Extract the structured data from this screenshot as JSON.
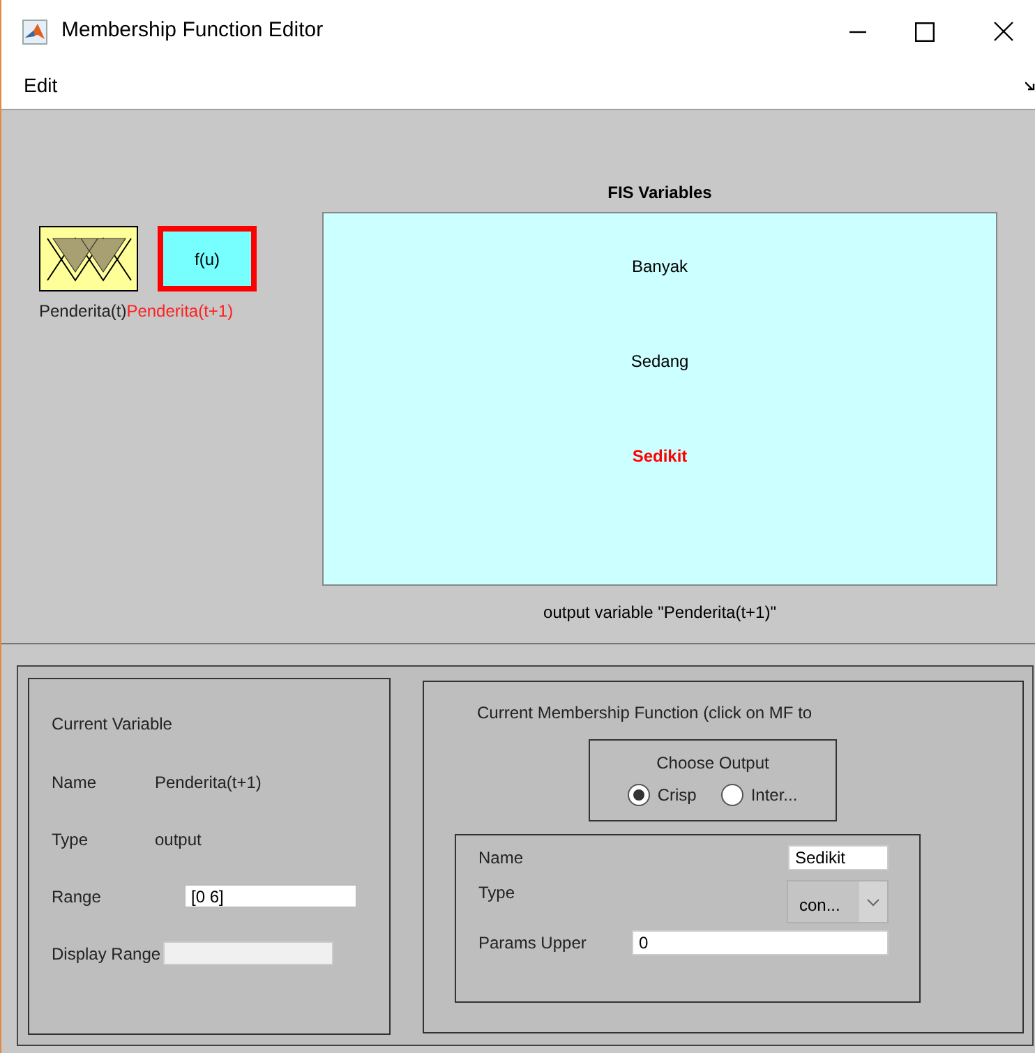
{
  "window": {
    "title": "Membership Function Editor"
  },
  "menu": [
    {
      "label": "Edit"
    }
  ],
  "variables": [
    {
      "kind": "input",
      "label": "Penderita(t)",
      "selected": false
    },
    {
      "kind": "output",
      "label": "Penderita(t+1)",
      "icon_text": "f(u)",
      "selected": true
    }
  ],
  "fis_plot": {
    "title": "FIS Variables",
    "mfs": [
      {
        "label": "Banyak",
        "selected": false
      },
      {
        "label": "Sedang",
        "selected": false
      },
      {
        "label": "Sedikit",
        "selected": true
      }
    ],
    "caption": "output variable \"Penderita(t+1)\""
  },
  "current_variable": {
    "title": "Current Variable",
    "fields": [
      {
        "kind": "text",
        "label": "Name",
        "value": "Penderita(t+1)"
      },
      {
        "kind": "text",
        "label": "Type",
        "value": "output"
      },
      {
        "kind": "input",
        "label": "Range",
        "value": "[0 6]"
      },
      {
        "kind": "disabled_input",
        "label": "Display Range"
      }
    ]
  },
  "current_mf": {
    "title": "Current Membership Function (click on MF to",
    "choose_output": {
      "title": "Choose Output",
      "options": [
        {
          "label": "Crisp",
          "selected": true
        },
        {
          "label": "Inter...",
          "selected": false
        }
      ]
    },
    "name": {
      "label": "Name",
      "value": "Sedikit"
    },
    "type": {
      "label": "Type",
      "value": "con..."
    },
    "params": {
      "label": "Params Upper",
      "value": "0"
    }
  }
}
